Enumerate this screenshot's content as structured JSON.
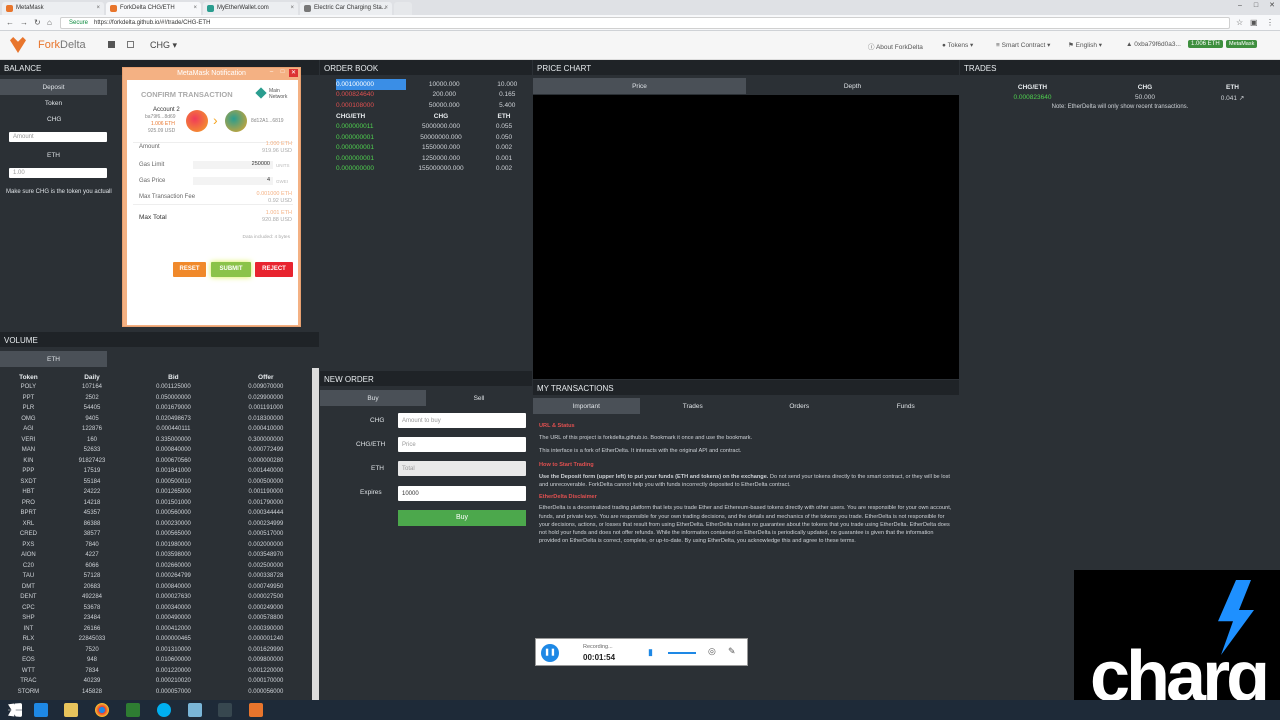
{
  "browser": {
    "tabs": [
      {
        "label": "MetaMask"
      },
      {
        "label": "ForkDelta CHG/ETH"
      },
      {
        "label": "MyEtherWallet.com"
      },
      {
        "label": "Electric Car Charging Sta..."
      }
    ],
    "secure": "Secure",
    "url": "https://forkdelta.github.io/#!/trade/CHG-ETH"
  },
  "app": {
    "brand_a": "Fork",
    "brand_b": "Delta",
    "token": "CHG ▾",
    "nav": {
      "about": "About ForkDelta",
      "tokens": "Tokens ▾",
      "smart_contract": "Smart Contract ▾",
      "language": "English ▾",
      "account": "0xba79f6d0a3...",
      "balance_badge": "1.006 ETH",
      "metamask_badge": "MetaMask"
    }
  },
  "balance": {
    "title": "BALANCE",
    "tabs": [
      "Deposit",
      "Token"
    ],
    "chg_label": "CHG",
    "amount_placeholder": "Amount",
    "eth_label": "ETH",
    "eth_value": "1.00",
    "note": "Make sure CHG is the token you actuall"
  },
  "metamask": {
    "title": "MetaMask Notification",
    "heading": "CONFIRM TRANSACTION",
    "network": "Main Network",
    "account_name": "Account 2",
    "account_addr": "ba79f6...8d69",
    "account_eth": "1.006 ETH",
    "account_usd": "925.09 USD",
    "to_addr": "8d12A1...6819",
    "rows": [
      {
        "label": "Amount",
        "v1": "1.000 ETH",
        "v2": "919.96 USD"
      },
      {
        "label": "Gas Limit",
        "v1": "250000",
        "v2": "UNITS"
      },
      {
        "label": "Gas Price",
        "v1": "4",
        "v2": "GWEI"
      },
      {
        "label": "Max Transaction Fee",
        "v1": "0.001000 ETH",
        "v2": "0.92 USD"
      },
      {
        "label": "Max Total",
        "v1": "1.001 ETH",
        "v2": "920.88 USD"
      }
    ],
    "data_note": "Data included: 4 bytes",
    "reset": "RESET",
    "submit": "SUBMIT",
    "reject": "REJECT"
  },
  "order_book": {
    "title": "ORDER BOOK",
    "sells": [
      [
        "0.001000000",
        "10000.000",
        "10.000"
      ],
      [
        "0.000824640",
        "200.000",
        "0.165"
      ],
      [
        "0.000108000",
        "50000.000",
        "5.400"
      ]
    ],
    "headers": [
      "CHG/ETH",
      "CHG",
      "ETH"
    ],
    "buys": [
      [
        "0.000000011",
        "5000000.000",
        "0.055"
      ],
      [
        "0.000000001",
        "50000000.000",
        "0.050"
      ],
      [
        "0.000000001",
        "1550000.000",
        "0.002"
      ],
      [
        "0.000000001",
        "1250000.000",
        "0.001"
      ],
      [
        "0.000000000",
        "155000000.000",
        "0.002"
      ]
    ]
  },
  "price_chart": {
    "title": "PRICE CHART",
    "tabs": [
      "Price",
      "Depth"
    ]
  },
  "trades": {
    "title": "TRADES",
    "headers": [
      "CHG/ETH",
      "CHG",
      "ETH"
    ],
    "row": [
      "0.000823640",
      "50.000",
      "0.041"
    ],
    "note": "Note: EtherDelta will only show recent transactions."
  },
  "volume": {
    "title": "VOLUME",
    "tab": "ETH",
    "headers": [
      "Token",
      "Daily",
      "Bid",
      "Offer"
    ],
    "rows": [
      [
        "POLY",
        "107164",
        "0.001125000",
        "0.009070000"
      ],
      [
        "PPT",
        "2502",
        "0.050000000",
        "0.029900000"
      ],
      [
        "PLR",
        "54405",
        "0.001679000",
        "0.001191000"
      ],
      [
        "OMG",
        "9405",
        "0.020498673",
        "0.018300000"
      ],
      [
        "AGI",
        "122876",
        "0.000440111",
        "0.000410000"
      ],
      [
        "VERI",
        "160",
        "0.335000000",
        "0.300000000"
      ],
      [
        "MAN",
        "52633",
        "0.000840000",
        "0.000772499"
      ],
      [
        "KIN",
        "91827423",
        "0.000670560",
        "0.000000280"
      ],
      [
        "PPP",
        "17519",
        "0.001841000",
        "0.001440000"
      ],
      [
        "SXDT",
        "55184",
        "0.000500010",
        "0.000500000"
      ],
      [
        "HBT",
        "24222",
        "0.001265000",
        "0.001190000"
      ],
      [
        "PRO",
        "14218",
        "0.001501000",
        "0.001790000"
      ],
      [
        "BPRT",
        "45357",
        "0.000560000",
        "0.000344444"
      ],
      [
        "XRL",
        "86388",
        "0.000230000",
        "0.000234999"
      ],
      [
        "CRED",
        "38577",
        "0.000565000",
        "0.000517000"
      ],
      [
        "PXS",
        "7840",
        "0.001980000",
        "0.002000000"
      ],
      [
        "AION",
        "4227",
        "0.003598000",
        "0.003548970"
      ],
      [
        "C20",
        "6066",
        "0.002660000",
        "0.002500000"
      ],
      [
        "TAU",
        "57128",
        "0.000264799",
        "0.000338728"
      ],
      [
        "DMT",
        "20683",
        "0.000840000",
        "0.000749950"
      ],
      [
        "DENT",
        "492284",
        "0.000027630",
        "0.000027500"
      ],
      [
        "CPC",
        "53678",
        "0.000340000",
        "0.000249000"
      ],
      [
        "SHP",
        "23484",
        "0.000490000",
        "0.000578800"
      ],
      [
        "INT",
        "26166",
        "0.000412000",
        "0.000390000"
      ],
      [
        "RLX",
        "22845033",
        "0.000000465",
        "0.000001240"
      ],
      [
        "PRL",
        "7520",
        "0.001310000",
        "0.001629990"
      ],
      [
        "EOS",
        "948",
        "0.010600000",
        "0.009800000"
      ],
      [
        "WTT",
        "7834",
        "0.001220000",
        "0.001220000"
      ],
      [
        "TRAC",
        "40239",
        "0.000210020",
        "0.000170000"
      ],
      [
        "STORM",
        "145828",
        "0.000057000",
        "0.000056000"
      ]
    ]
  },
  "new_order": {
    "title": "NEW ORDER",
    "tabs": [
      "Buy",
      "Sell"
    ],
    "fields": [
      {
        "label": "CHG",
        "value": "Amount to buy"
      },
      {
        "label": "CHG/ETH",
        "value": "Price"
      },
      {
        "label": "ETH",
        "value": "Total"
      },
      {
        "label": "Expires",
        "value": "10000"
      }
    ],
    "button": "Buy"
  },
  "my_tx": {
    "title": "MY TRANSACTIONS",
    "tabs": [
      "Important",
      "Trades",
      "Orders",
      "Funds"
    ],
    "h1": "URL & Status",
    "p1": "The URL of this project is forkdelta.github.io. Bookmark it once and use the bookmark.",
    "p2": "This interface is a fork of EtherDelta. It interacts with the original API and contract.",
    "h2": "How to Start Trading",
    "p3b": "Use the Deposit form (upper left) to put your funds (ETH and tokens) on the exchange.",
    "p3": " Do not send your tokens directly to the smart contract, or they will be lost and unrecoverable. ForkDelta cannot help you with funds incorrectly deposited to EtherDelta contract.",
    "h3": "EtherDelta Disclaimer",
    "p4": "EtherDelta is a decentralized trading platform that lets you trade Ether and Ethereum-based tokens directly with other users. You are responsible for your own account, funds, and private keys. You are responsible for your own trading decisions, and the details and mechanics of the tokens you trade. EtherDelta is not responsible for your decisions, actions, or losses that result from using EtherDelta. EtherDelta makes no guarantee about the tokens that you trade using EtherDelta. EtherDelta does not hold your funds and does not offer refunds. While the information contained on EtherDelta is periodically updated, no guarantee is given that the information provided on EtherDelta is correct, complete, or up-to-date. By using EtherDelta, you acknowledge this and agree to these terms."
  },
  "recorder": {
    "status": "Recording...",
    "time": "00:01:54"
  },
  "overlay": {
    "logo": "charg"
  }
}
